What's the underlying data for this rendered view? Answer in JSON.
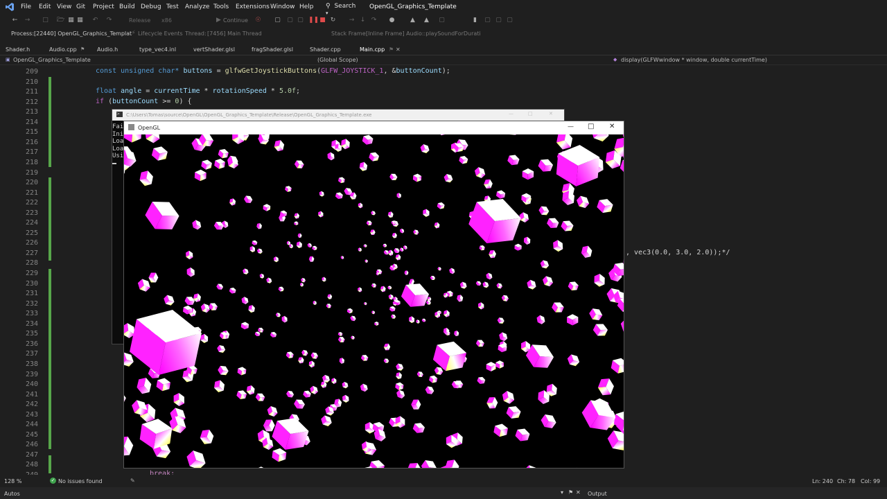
{
  "menubar": {
    "items": [
      "File",
      "Edit",
      "View",
      "Git",
      "Project",
      "Build",
      "Debug",
      "Test",
      "Analyze",
      "Tools",
      "Extensions",
      "Window",
      "Help"
    ],
    "search_label": "Search",
    "solution_name": "OpenGL_Graphics_Template"
  },
  "toolbar": {
    "config": "Release",
    "platform": "x86",
    "continue_label": "Continue",
    "process_label": "Process:",
    "process_value": "[22440] OpenGL_Graphics_Templat",
    "lifecycle_label": "Lifecycle Events",
    "thread_label": "Thread:",
    "thread_value": "[7456] Main Thread",
    "stack_frame_label": "Stack Frame:",
    "stack_frame_value": "[Inline Frame] Audio::playSoundForDurati"
  },
  "tabs": [
    {
      "label": "Shader.h"
    },
    {
      "label": "Audio.cpp"
    },
    {
      "label": "Audio.h"
    },
    {
      "label": "type_vec4.inl"
    },
    {
      "label": "vertShader.glsl"
    },
    {
      "label": "fragShader.glsl"
    },
    {
      "label": "Shader.cpp"
    },
    {
      "label": "Main.cpp"
    }
  ],
  "navbar": {
    "project": "OpenGL_Graphics_Template",
    "scope": "(Global Scope)",
    "function": "display(GLFWwindow * window, double currentTime)"
  },
  "line_numbers": [
    "209",
    "210",
    "211",
    "212",
    "213",
    "214",
    "215",
    "216",
    "217",
    "218",
    "219",
    "220",
    "221",
    "222",
    "223",
    "224",
    "225",
    "226",
    "227",
    "228",
    "229",
    "230",
    "231",
    "232",
    "233",
    "234",
    "235",
    "236",
    "237",
    "238",
    "239",
    "240",
    "241",
    "242",
    "243",
    "244",
    "245",
    "246",
    "247",
    "248",
    "249"
  ],
  "code": {
    "l209_a": "const unsigned char* ",
    "l209_b": "buttons",
    "l209_c": " = ",
    "l209_d": "glfwGetJoystickButtons",
    "l209_e": "(",
    "l209_f": "GLFW_JOYSTICK_1",
    "l209_g": ", &",
    "l209_h": "buttonCount",
    "l209_i": ");",
    "l211_a": "float ",
    "l211_b": "angle",
    "l211_c": " = ",
    "l211_d": "currentTime",
    "l211_e": " * ",
    "l211_f": "rotationSpeed",
    "l211_g": " * ",
    "l211_h": "5.0f",
    "l211_i": ";",
    "l212_a": "if ",
    "l212_b": "(",
    "l212_c": "buttonCount",
    "l212_d": " >= ",
    "l212_e": "0",
    "l212_f": ") {",
    "l227_a": ", vec3(0.0, 3.0, 2.0));*/",
    "l248_a": "break;"
  },
  "console": {
    "title": "C:\\Users\\Tomas\\source\\OpenGL\\OpenGL_Graphics_Template\\Release\\OpenGL_Graphics_Template.exe",
    "lines": [
      "Fai",
      "Ini",
      "Loa",
      "Loa",
      "Usi"
    ]
  },
  "glwindow": {
    "title": "OpenGL",
    "colors": {
      "magenta": "#ff00ff",
      "white": "#ffffff",
      "yellow": "#ffff00"
    }
  },
  "statusbar": {
    "zoom": "128 %",
    "issues": "No issues found",
    "ln": "Ln: 240",
    "ch": "Ch: 78",
    "col": "Col: 99"
  },
  "bottombar": {
    "autos": "Autos",
    "output": "Output"
  }
}
